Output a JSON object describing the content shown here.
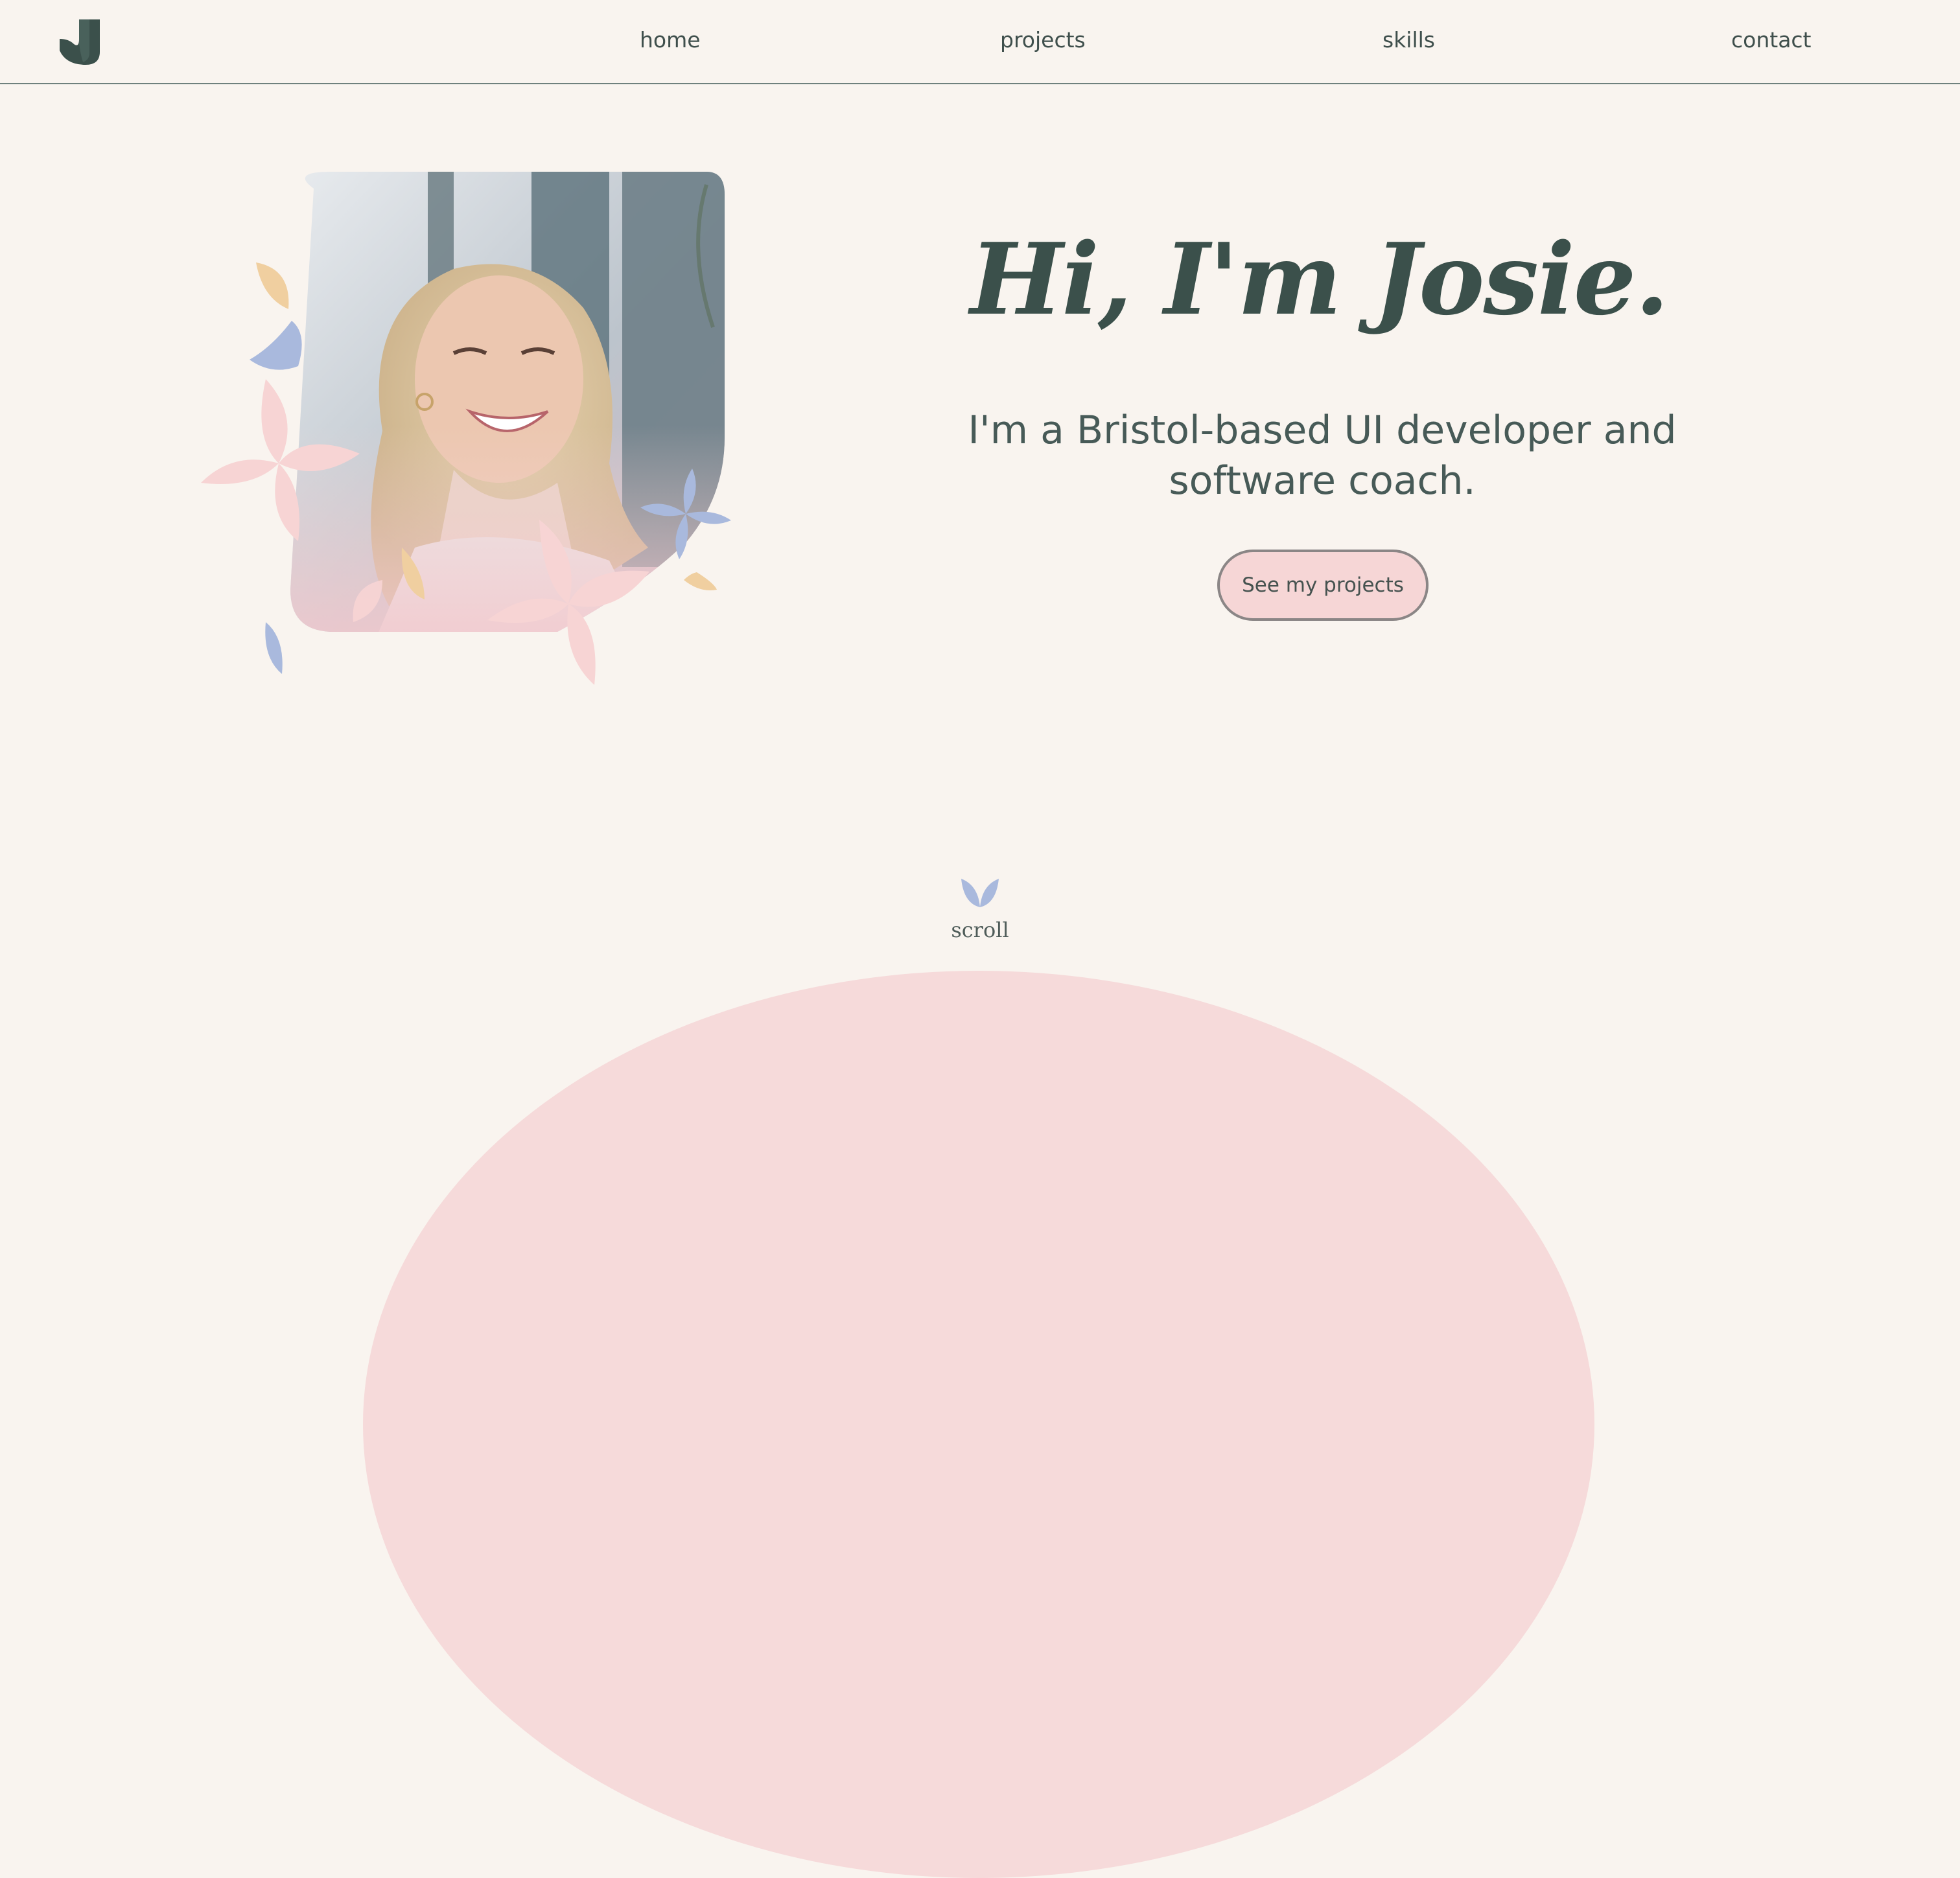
{
  "header": {
    "logo_letter": "J",
    "nav": [
      {
        "label": "home"
      },
      {
        "label": "projects"
      },
      {
        "label": "skills"
      },
      {
        "label": "contact"
      }
    ]
  },
  "hero": {
    "photo_icon": "portrait-photo",
    "heading": "Hi, I'm Josie.",
    "subtitle": "I'm a Bristol-based UI developer and software coach.",
    "cta_label": "See my projects"
  },
  "scroll": {
    "icon": "leaf-icon",
    "label": "scroll"
  },
  "colors": {
    "background": "#f9f4ef",
    "brand_green": "#3b504b",
    "petal_pink": "#f7d4d4",
    "petal_blue": "#a9b9dd",
    "petal_orange": "#f0cfa0",
    "button_fill": "#f6d6d6"
  }
}
